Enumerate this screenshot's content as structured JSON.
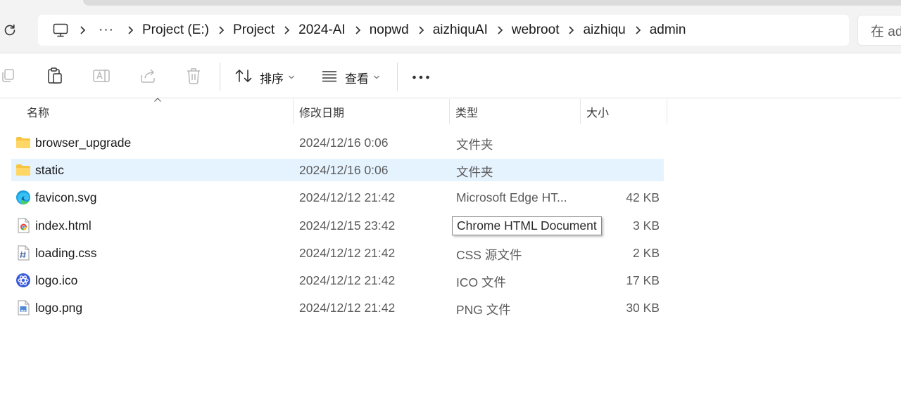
{
  "address_bar": {
    "overflow": "···",
    "crumbs": [
      "Project (E:)",
      "Project",
      "2024-AI",
      "nopwd",
      "aizhiquAI",
      "webroot",
      "aizhiqu",
      "admin"
    ]
  },
  "search": {
    "placeholder": "在 ad"
  },
  "toolbar": {
    "sort_label": "排序",
    "view_label": "查看"
  },
  "columns": {
    "name": "名称",
    "date": "修改日期",
    "type": "类型",
    "size": "大小"
  },
  "files": [
    {
      "name": "browser_upgrade",
      "date": "2024/12/16 0:06",
      "type": "文件夹",
      "size": "",
      "icon": "folder-icon"
    },
    {
      "name": "static",
      "date": "2024/12/16 0:06",
      "type": "文件夹",
      "size": "",
      "icon": "folder-icon"
    },
    {
      "name": "favicon.svg",
      "date": "2024/12/12 21:42",
      "type": "Microsoft Edge HT...",
      "size": "42 KB",
      "icon": "edge-icon"
    },
    {
      "name": "index.html",
      "date": "2024/12/15 23:42",
      "type": "",
      "size": "3 KB",
      "icon": "chrome-html-icon"
    },
    {
      "name": "loading.css",
      "date": "2024/12/12 21:42",
      "type": "CSS 源文件",
      "size": "2 KB",
      "icon": "css-file-icon"
    },
    {
      "name": "logo.ico",
      "date": "2024/12/12 21:42",
      "type": "ICO 文件",
      "size": "17 KB",
      "icon": "ico-file-icon"
    },
    {
      "name": "logo.png",
      "date": "2024/12/12 21:42",
      "type": "PNG 文件",
      "size": "30 KB",
      "icon": "image-file-icon"
    }
  ],
  "tooltip": {
    "text": "Chrome HTML Document"
  },
  "colors": {
    "selection": "#e5f3ff",
    "folder": "#f8c542",
    "accent": "#0067c0"
  }
}
